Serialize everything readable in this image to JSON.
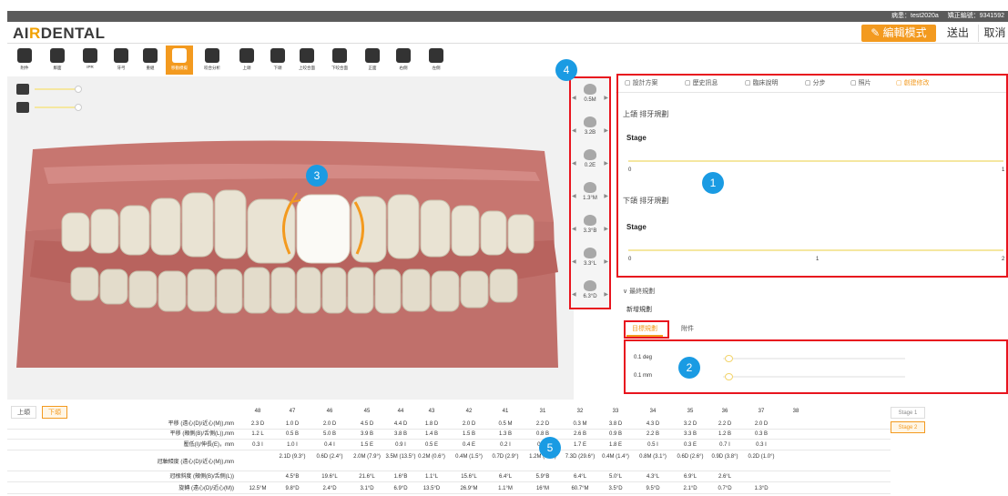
{
  "topbar": {
    "case_label": "病患：test2020a",
    "ortho_label": "矯正編號：9341592"
  },
  "header": {
    "logo_prefix": "AI",
    "logo_mark": "R",
    "logo_suffix": "DENTAL",
    "edit_label": "✎ 編輯模式",
    "export_label": "送出",
    "cancel_label": "取消"
  },
  "toolbar": {
    "tools": [
      {
        "label": "附件",
        "icon": "attachment-icon"
      },
      {
        "label": "鄰面",
        "icon": "grid-icon"
      },
      {
        "label": "IPR",
        "icon": "ipr-icon"
      },
      {
        "label": "牙弓",
        "icon": "arch-icon"
      },
      {
        "label": "重組",
        "icon": "rebuild-icon"
      },
      {
        "label": "移動模擬",
        "icon": "move-icon"
      },
      {
        "label": "咬合分析",
        "icon": "occlusion-icon"
      },
      {
        "label": "上頜",
        "icon": "upper-jaw-icon"
      },
      {
        "label": "下頜",
        "icon": "lower-jaw-icon"
      },
      {
        "label": "上咬合面",
        "icon": "upper-occlusal-icon"
      },
      {
        "label": "下咬合面",
        "icon": "lower-occlusal-icon"
      },
      {
        "label": "正面",
        "icon": "front-view-icon"
      },
      {
        "label": "右側",
        "icon": "right-view-icon"
      },
      {
        "label": "左側",
        "icon": "left-view-icon"
      }
    ],
    "active_index": 5
  },
  "viewport": {
    "slider1_level": 0.3,
    "slider2_level": 0.3
  },
  "dials": [
    {
      "value": "0.5M",
      "icon": "tooth-mesial-icon"
    },
    {
      "value": "3.2B",
      "icon": "tooth-buccal-icon"
    },
    {
      "value": "0.2E",
      "icon": "tooth-extrusion-icon"
    },
    {
      "value": "1.3°M",
      "icon": "tooth-rotate-icon"
    },
    {
      "value": "3.3°B",
      "icon": "tooth-tip-icon"
    },
    {
      "value": "3.3°L",
      "icon": "tooth-torque-icon"
    },
    {
      "value": "6.3°D",
      "icon": "tooth-distal-icon"
    }
  ],
  "panel": {
    "tabs": [
      {
        "label": "設計方案",
        "icon": "doc-icon"
      },
      {
        "label": "歷史訊息",
        "icon": "history-icon"
      },
      {
        "label": "臨床說明",
        "icon": "notes-icon"
      },
      {
        "label": "分步",
        "icon": "steps-icon"
      },
      {
        "label": "照片",
        "icon": "photo-icon"
      },
      {
        "label": "創建修改",
        "icon": "edit-icon"
      }
    ],
    "active_tab": 5,
    "upper_title": "上頜 排牙規劃",
    "upper_stage_label": "Stage",
    "upper_min": "0",
    "upper_max": "1",
    "lower_title": "下頜 排牙規劃",
    "lower_stage_label": "Stage",
    "lower_min": "0",
    "lower_mid": "1",
    "lower_max": "2",
    "final_label": "最終規劃",
    "new_label": "新增規劃",
    "subtab_target": "目標規劃",
    "subtab_attach": "附件",
    "deg_label": "0.1 deg",
    "mm_label": "0.1 mm"
  },
  "badges": [
    "1",
    "2",
    "3",
    "4",
    "5"
  ],
  "table": {
    "jaw_upper": "上頜",
    "jaw_lower": "下頜",
    "teeth": [
      "48",
      "47",
      "46",
      "45",
      "44",
      "43",
      "42",
      "41",
      "31",
      "32",
      "33",
      "34",
      "35",
      "36",
      "37",
      "38"
    ],
    "rows": [
      {
        "label": "平移 (遠心(D)/近心(M)),mm",
        "cells": [
          "2.3 D",
          "1.0 D",
          "2.0 D",
          "4.5 D",
          "4.4 D",
          "1.8 D",
          "2.0 D",
          "0.5 M",
          "2.2 D",
          "0.3 M",
          "3.8 D",
          "4.3 D",
          "3.2 D",
          "2.2 D",
          "2.0 D",
          ""
        ]
      },
      {
        "label": "平移 (頰側(B)/舌側(L)),mm",
        "cells": [
          "1.2 L",
          "0.5 B",
          "5.0 B",
          "3.9 B",
          "3.8 B",
          "1.4 B",
          "1.5 B",
          "1.3 B",
          "0.8 B",
          "2.6 B",
          "0.9 B",
          "2.2 B",
          "3.3 B",
          "1.2 B",
          "0.3 B",
          ""
        ]
      },
      {
        "label": "壓低(I)/伸長(E)，mm",
        "cells": [
          "0.3 I",
          "1.0 I",
          "0.4 I",
          "1.5 E",
          "0.9 I",
          "0.5 E",
          "0.4 E",
          "0.2 I",
          "0.8 I",
          "1.7 E",
          "1.8 E",
          "0.5 I",
          "0.3 E",
          "0.7 I",
          "0.3 I",
          ""
        ]
      },
      {
        "label": "冠軸傾度 (遠心(D)/近心(M)),mm",
        "cells": [
          "",
          "2.1D (9.3°)",
          "0.6D (2.4°)",
          "2.0M (7.9°)",
          "3.5M (13.5°)",
          "0.2M (0.6°)",
          "0.4M (1.5°)",
          "0.7D (2.9°)",
          "1.2M (5.3°)",
          "7.3D (29.6°)",
          "0.4M (1.4°)",
          "0.8M (3.1°)",
          "0.6D (2.6°)",
          "0.9D (3.8°)",
          "0.2D (1.0°)",
          ""
        ]
      },
      {
        "label": "冠根斜度 (頰側(B)/舌側(L))",
        "cells": [
          "",
          "4.5°B",
          "19.6°L",
          "21.6°L",
          "1.6°B",
          "1.1°L",
          "15.6°L",
          "6.4°L",
          "5.9°B",
          "6.4°L",
          "5.0°L",
          "4.3°L",
          "6.9°L",
          "2.6°L",
          "",
          ""
        ]
      },
      {
        "label": "旋轉 (遠心(D)/近心(M))",
        "cells": [
          "12.5°M",
          "9.8°D",
          "2.4°D",
          "3.1°D",
          "6.9°D",
          "13.5°D",
          "26.9°M",
          "1.1°M",
          "16°M",
          "60.7°M",
          "3.5°D",
          "9.5°D",
          "2.1°D",
          "0.7°D",
          "1.3°D",
          ""
        ]
      }
    ]
  },
  "stages": [
    "Stage 1",
    "Stage 2"
  ],
  "active_stage": 1,
  "colors": {
    "accent": "#f39a1f",
    "badge": "#1a9be3",
    "highlight": "#e8141e",
    "gum": "#c77670"
  }
}
